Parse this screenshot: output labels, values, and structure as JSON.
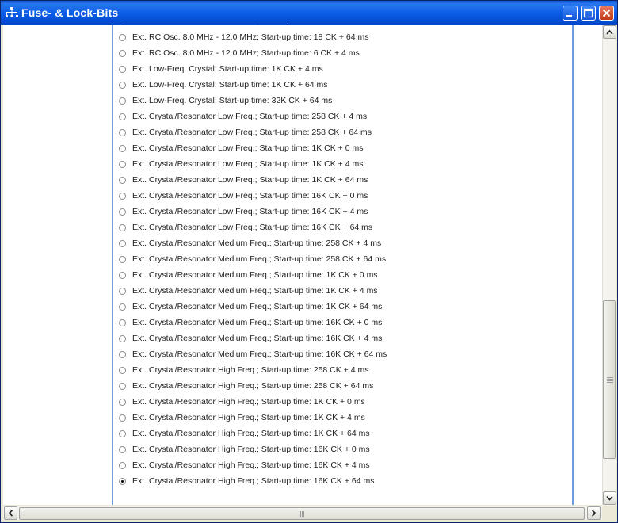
{
  "window": {
    "title": "Fuse- & Lock-Bits",
    "icons": {
      "app": "network-tree-icon",
      "minimize": "minimize-icon",
      "maximize": "maximize-icon",
      "close": "close-icon"
    }
  },
  "options": [
    {
      "label": "Ext. RC Osc. 8.0 MHz - 12.0 MHz; Start-up time: 18 CK + 4 ms",
      "checked": false
    },
    {
      "label": "Ext. RC Osc. 8.0 MHz - 12.0 MHz; Start-up time: 18 CK + 64 ms",
      "checked": false
    },
    {
      "label": "Ext. RC Osc. 8.0 MHz - 12.0 MHz; Start-up time: 6 CK + 4 ms",
      "checked": false
    },
    {
      "label": "Ext. Low-Freq. Crystal; Start-up time: 1K CK + 4 ms",
      "checked": false
    },
    {
      "label": "Ext. Low-Freq. Crystal; Start-up time: 1K CK + 64 ms",
      "checked": false
    },
    {
      "label": "Ext. Low-Freq. Crystal; Start-up time: 32K CK + 64 ms",
      "checked": false
    },
    {
      "label": "Ext. Crystal/Resonator Low Freq.; Start-up time: 258 CK + 4 ms",
      "checked": false
    },
    {
      "label": "Ext. Crystal/Resonator Low Freq.; Start-up time: 258 CK + 64 ms",
      "checked": false
    },
    {
      "label": "Ext. Crystal/Resonator Low Freq.; Start-up time: 1K CK + 0 ms",
      "checked": false
    },
    {
      "label": "Ext. Crystal/Resonator Low Freq.; Start-up time: 1K CK + 4 ms",
      "checked": false
    },
    {
      "label": "Ext. Crystal/Resonator Low Freq.; Start-up time: 1K CK + 64 ms",
      "checked": false
    },
    {
      "label": "Ext. Crystal/Resonator Low Freq.; Start-up time: 16K CK + 0 ms",
      "checked": false
    },
    {
      "label": "Ext. Crystal/Resonator Low Freq.; Start-up time: 16K CK + 4 ms",
      "checked": false
    },
    {
      "label": "Ext. Crystal/Resonator Low Freq.; Start-up time: 16K CK + 64 ms",
      "checked": false
    },
    {
      "label": "Ext. Crystal/Resonator Medium Freq.; Start-up time: 258 CK + 4 ms",
      "checked": false
    },
    {
      "label": "Ext. Crystal/Resonator Medium Freq.; Start-up time: 258 CK + 64 ms",
      "checked": false
    },
    {
      "label": "Ext. Crystal/Resonator Medium Freq.; Start-up time: 1K CK + 0 ms",
      "checked": false
    },
    {
      "label": "Ext. Crystal/Resonator Medium Freq.; Start-up time: 1K CK + 4 ms",
      "checked": false
    },
    {
      "label": "Ext. Crystal/Resonator Medium Freq.; Start-up time: 1K CK + 64 ms",
      "checked": false
    },
    {
      "label": "Ext. Crystal/Resonator Medium Freq.; Start-up time: 16K CK + 0 ms",
      "checked": false
    },
    {
      "label": "Ext. Crystal/Resonator Medium Freq.; Start-up time: 16K CK + 4 ms",
      "checked": false
    },
    {
      "label": "Ext. Crystal/Resonator Medium Freq.; Start-up time: 16K CK + 64 ms",
      "checked": false
    },
    {
      "label": "Ext. Crystal/Resonator High Freq.; Start-up time: 258 CK + 4 ms",
      "checked": false
    },
    {
      "label": "Ext. Crystal/Resonator High Freq.; Start-up time: 258 CK + 64 ms",
      "checked": false
    },
    {
      "label": "Ext. Crystal/Resonator High Freq.; Start-up time: 1K CK + 0 ms",
      "checked": false
    },
    {
      "label": "Ext. Crystal/Resonator High Freq.; Start-up time: 1K CK + 4 ms",
      "checked": false
    },
    {
      "label": "Ext. Crystal/Resonator High Freq.; Start-up time: 1K CK + 64 ms",
      "checked": false
    },
    {
      "label": "Ext. Crystal/Resonator High Freq.; Start-up time: 16K CK + 0 ms",
      "checked": false
    },
    {
      "label": "Ext. Crystal/Resonator High Freq.; Start-up time: 16K CK + 4 ms",
      "checked": false
    },
    {
      "label": "Ext. Crystal/Resonator High Freq.; Start-up time: 16K CK + 64 ms",
      "checked": true
    }
  ],
  "colors": {
    "title_bar": "#0c5ee8",
    "panel_border": "#6f9be0",
    "client_bg": "#ffffff"
  }
}
